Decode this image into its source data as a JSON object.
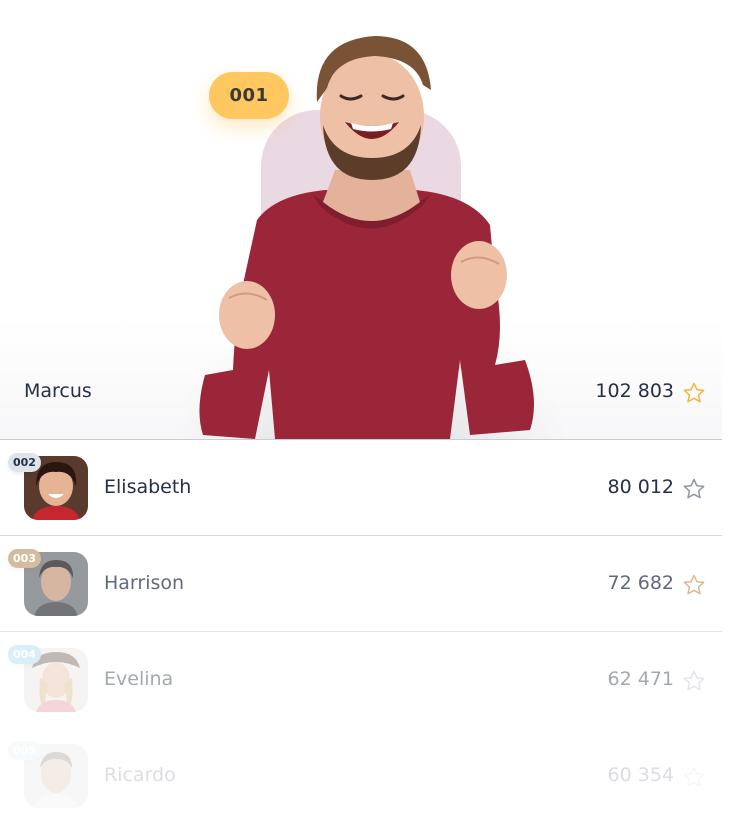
{
  "winner": {
    "rank": "001",
    "name": "Marcus",
    "score": "102 803",
    "badge_color": "#ffc75f",
    "star_color": "#f5b43a",
    "icon": "star-outline-icon"
  },
  "leaderboard": [
    {
      "rank": "002",
      "name": "Elisabeth",
      "score": "80 012",
      "rank_color": "#dfe3ea",
      "rank_text_color": "#24304a",
      "star_color": "#8d95a5",
      "opacity": 1,
      "icon": "star-outline-icon"
    },
    {
      "rank": "003",
      "name": "Harrison",
      "score": "72 682",
      "rank_color": "#c3a47e",
      "rank_text_color": "#ffffff",
      "star_color": "#c8a06a",
      "opacity": 0.72,
      "icon": "star-outline-icon"
    },
    {
      "rank": "004",
      "name": "Evelina",
      "score": "62 471",
      "rank_color": "#a9d7f2",
      "rank_text_color": "#ffffff",
      "star_color": "#b8bfcb",
      "opacity": 0.42,
      "icon": "star-outline-icon"
    },
    {
      "rank": "005",
      "name": "Ricardo",
      "score": "60 354",
      "rank_color": "#c9e6f7",
      "rank_text_color": "#ffffff",
      "star_color": "#c8ced8",
      "opacity": 0.16,
      "icon": "star-outline-icon"
    }
  ]
}
